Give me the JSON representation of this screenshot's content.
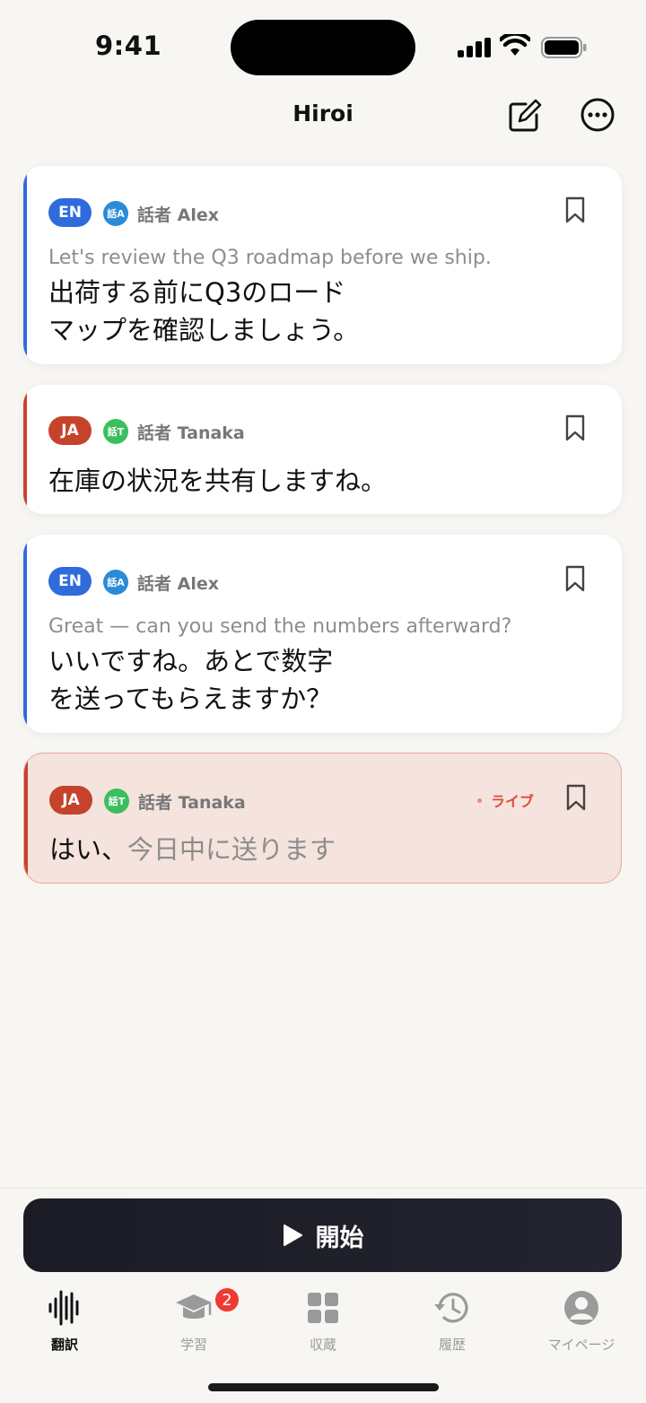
{
  "status_bar": {
    "time": "9:41"
  },
  "nav": {
    "title": "Hiroi"
  },
  "cards": [
    {
      "lang": "EN",
      "speaker_icon": "話A",
      "speaker": "話者 Alex",
      "source": "Let's review the Q3 roadmap before we ship.",
      "translation_line1": "出荷する前にQ3のロード",
      "translation_line2": "マップを確認しましょう。"
    },
    {
      "lang": "JA",
      "speaker_icon": "話T",
      "speaker": "話者 Tanaka",
      "translation": "在庫の状況を共有しますね。"
    },
    {
      "lang": "EN",
      "speaker_icon": "話A",
      "speaker": "話者 Alex",
      "source": "Great — can you send the numbers afterward?",
      "translation_line1": "いいですね。あとで数字",
      "translation_line2": "を送ってもらえますか？"
    },
    {
      "lang": "JA",
      "speaker_icon": "話T",
      "speaker": "話者 Tanaka",
      "live_label": "ライブ",
      "translation_confirmed": "はい、",
      "translation_pending": "今日中に送ります"
    }
  ],
  "start_button": {
    "label": "開始"
  },
  "tabs": [
    {
      "label": "翻訳",
      "icon": "waveform-icon"
    },
    {
      "label": "学習",
      "icon": "graduation-cap-icon",
      "badge": "2"
    },
    {
      "label": "収蔵",
      "icon": "grid-icon"
    },
    {
      "label": "履歴",
      "icon": "history-icon"
    },
    {
      "label": "マイページ",
      "icon": "person-icon"
    }
  ],
  "colors": {
    "en_accent": "#2f6bdb",
    "ja_accent": "#c5432b",
    "live_bg": "#f5e3dd",
    "live_text": "#e24b3b"
  }
}
